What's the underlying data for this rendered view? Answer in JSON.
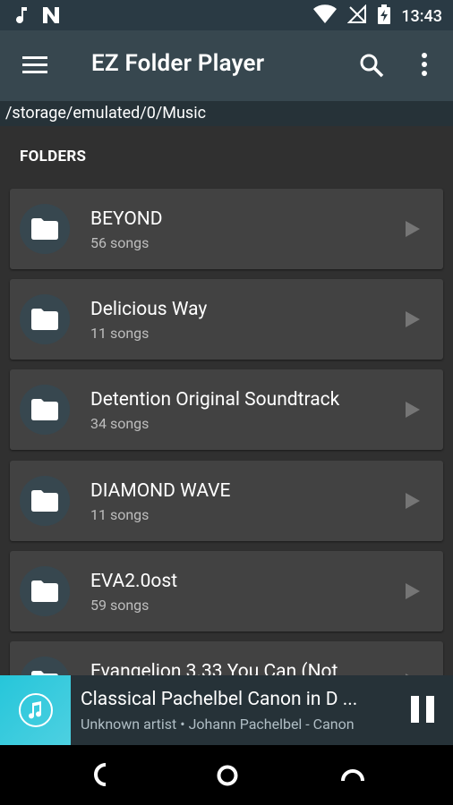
{
  "status_bar": {
    "time": "13:43",
    "icons": [
      "music-note-icon",
      "n-icon",
      "wifi-icon",
      "no-signal-icon",
      "battery-charging-icon"
    ]
  },
  "app_bar": {
    "title": "EZ Folder Player",
    "icons": [
      "menu-icon",
      "search-icon",
      "more-vert-icon"
    ]
  },
  "path": "/storage/emulated/0/Music",
  "section_title": "FOLDERS",
  "folders": [
    {
      "name": "BEYOND",
      "count": "56 songs"
    },
    {
      "name": "Delicious Way",
      "count": "11 songs"
    },
    {
      "name": "Detention Original Soundtrack",
      "count": "34 songs"
    },
    {
      "name": "DIAMOND WAVE",
      "count": "11 songs"
    },
    {
      "name": "EVA2.0ost",
      "count": "59 songs"
    },
    {
      "name": "Evangelion 3.33 You Can (Not",
      "count": ""
    }
  ],
  "now_playing": {
    "title": "Classical Pachelbel Canon in D ...",
    "subtitle": "Unknown artist • Johann Pachelbel - Canon"
  },
  "colors": {
    "app_bar": "#37474f",
    "status_bar": "#2a3a44",
    "background": "#303030",
    "card": "#424242",
    "accent": "#26c6da"
  }
}
